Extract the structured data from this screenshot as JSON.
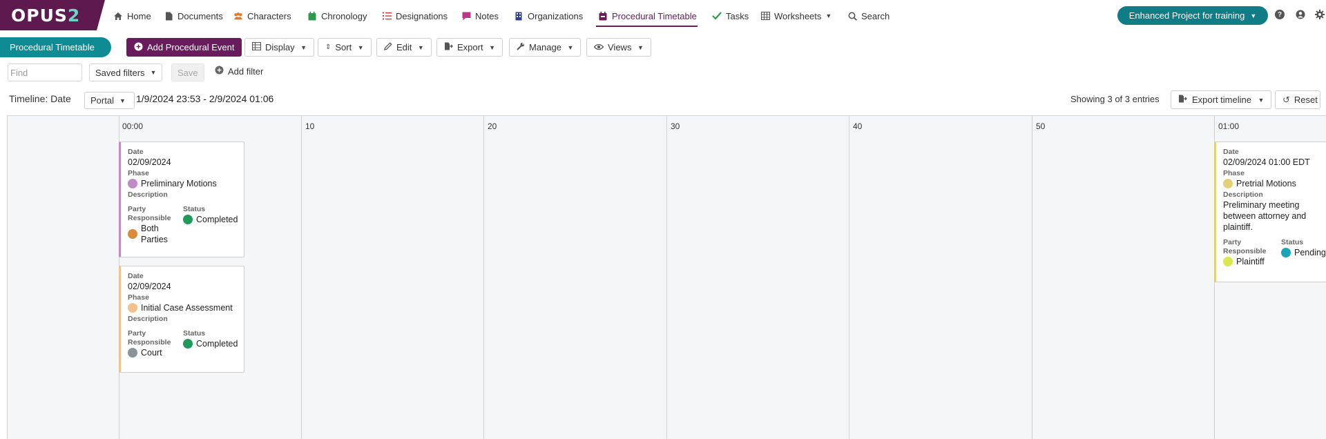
{
  "brand": {
    "logo_main": "OPUS",
    "logo_num": "2"
  },
  "nav": {
    "items": [
      {
        "label": "Home",
        "icon": "home-icon"
      },
      {
        "label": "Documents",
        "icon": "document-icon"
      },
      {
        "label": "Characters",
        "icon": "people-icon"
      },
      {
        "label": "Chronology",
        "icon": "calendar-icon"
      },
      {
        "label": "Designations",
        "icon": "list-icon"
      },
      {
        "label": "Notes",
        "icon": "note-icon"
      },
      {
        "label": "Organizations",
        "icon": "building-icon"
      },
      {
        "label": "Procedural Timetable",
        "icon": "timetable-icon",
        "active": true
      },
      {
        "label": "Tasks",
        "icon": "check-icon"
      },
      {
        "label": "Worksheets",
        "icon": "table-icon"
      },
      {
        "label": "Search",
        "icon": "search-icon"
      }
    ],
    "project_label": "Enhanced Project for training",
    "help": "?"
  },
  "toolbar": {
    "tab_label": "Procedural Timetable",
    "add_label": "Add Procedural Event",
    "display_label": "Display",
    "sort_label": "Sort",
    "edit_label": "Edit",
    "export_label": "Export",
    "manage_label": "Manage",
    "views_label": "Views"
  },
  "filters": {
    "find_placeholder": "Find",
    "saved_filters_label": "Saved filters",
    "save_label": "Save",
    "add_filter_label": "Add filter"
  },
  "timeline": {
    "label": "Timeline: Date",
    "portal_label": "Portal",
    "range": "1/9/2024 23:53 - 2/9/2024 01:06",
    "showing": "Showing 3 of 3 entries",
    "export_label": "Export timeline",
    "reset_label": "Reset",
    "ticks": [
      "00:00",
      "10",
      "20",
      "30",
      "40",
      "50",
      "01:00"
    ]
  },
  "labels": {
    "date": "Date",
    "phase": "Phase",
    "description": "Description",
    "party_line1": "Party",
    "party_line2": "Responsible",
    "status": "Status"
  },
  "events": [
    {
      "date": "02/09/2024",
      "phase": "Preliminary Motions",
      "phase_color": "#c08ac8",
      "description": "",
      "party": "Both Parties",
      "party_color": "#d98a3a",
      "status": "Completed",
      "status_color": "#1f9a5b",
      "accent": "#c08ac8"
    },
    {
      "date": "02/09/2024",
      "phase": "Initial Case Assessment",
      "phase_color": "#f3c08e",
      "description": "",
      "party": "Court",
      "party_color": "#8a929c",
      "status": "Completed",
      "status_color": "#1f9a5b",
      "accent": "#f3c08e"
    },
    {
      "date": "02/09/2024 01:00 EDT",
      "phase": "Pretrial Motions",
      "phase_color": "#e1d27a",
      "description": "Preliminary meeting between attorney and plaintiff.",
      "party": "Plaintiff",
      "party_color": "#d9e84a",
      "status": "Pending",
      "status_color": "#18a6b8",
      "accent": "#e1d27a"
    }
  ]
}
